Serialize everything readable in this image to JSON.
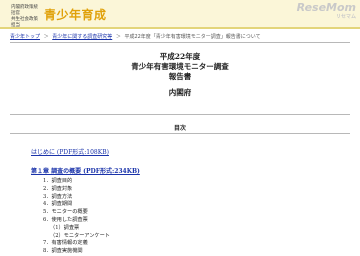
{
  "header": {
    "org_lines": [
      "内閣府政策統括官",
      "共生社会政策担当"
    ],
    "logo_text": "青少年育成",
    "watermark_main": "ReseMom",
    "watermark_sub": "リセマム"
  },
  "breadcrumb": {
    "items": [
      "青少年トップ",
      "青少年に関する調査研究等",
      "平成22年度「青少年有害環境モニター調査」報告書について"
    ],
    "separator": "＞"
  },
  "title": {
    "lines": [
      "平成22年度",
      "青少年有害環境モニター調査",
      "報告書"
    ],
    "agency": "内閣府"
  },
  "toc": {
    "heading": "目次",
    "intro_link": "はじめに (PDF形式:108KB)",
    "chapter1_link": "第１章 調査の概要 (PDF形式:234KB)",
    "items": [
      {
        "text": "1．調査目的",
        "sub": false
      },
      {
        "text": "2．調査対象",
        "sub": false
      },
      {
        "text": "3．調査方法",
        "sub": false
      },
      {
        "text": "4．調査期間",
        "sub": false
      },
      {
        "text": "5．モニターの概要",
        "sub": false
      },
      {
        "text": "6．使用した調査票",
        "sub": false
      },
      {
        "text": "（1）調査票",
        "sub": true
      },
      {
        "text": "（2）モニターアンケート",
        "sub": true
      },
      {
        "text": "7．有害情報の定義",
        "sub": false
      },
      {
        "text": "8．調査実施機関",
        "sub": false
      }
    ]
  }
}
